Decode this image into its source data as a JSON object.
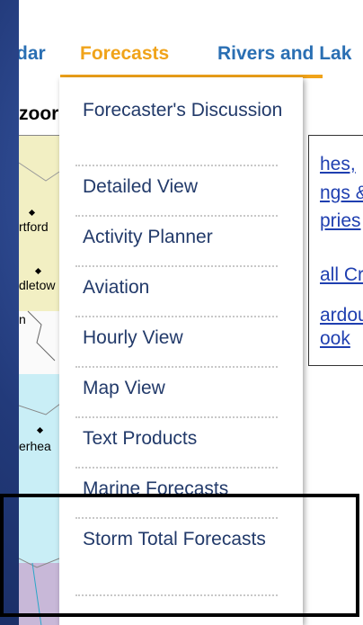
{
  "nav": {
    "items": [
      {
        "label": "dar"
      },
      {
        "label": "Forecasts",
        "active": true
      },
      {
        "label": "Rivers and Lak"
      }
    ],
    "active_color": "#f0a31a",
    "link_color": "#2a6fb3"
  },
  "page": {
    "zoom_label": "zoor",
    "map_towns": [
      "rtford",
      "dletow",
      "n",
      "erhea"
    ],
    "side_links": [
      "hes,",
      "ngs &",
      "pries",
      "all Cra",
      "ardou",
      "ook"
    ]
  },
  "dropdown": {
    "items": [
      {
        "label": "Forecaster's Discussion"
      },
      {
        "label": "Detailed View"
      },
      {
        "label": "Activity Planner"
      },
      {
        "label": "Aviation"
      },
      {
        "label": "Hourly View"
      },
      {
        "label": "Map View"
      },
      {
        "label": "Text Products"
      },
      {
        "label": "Marine Forecasts"
      },
      {
        "label": "Storm Total Forecasts"
      }
    ]
  }
}
